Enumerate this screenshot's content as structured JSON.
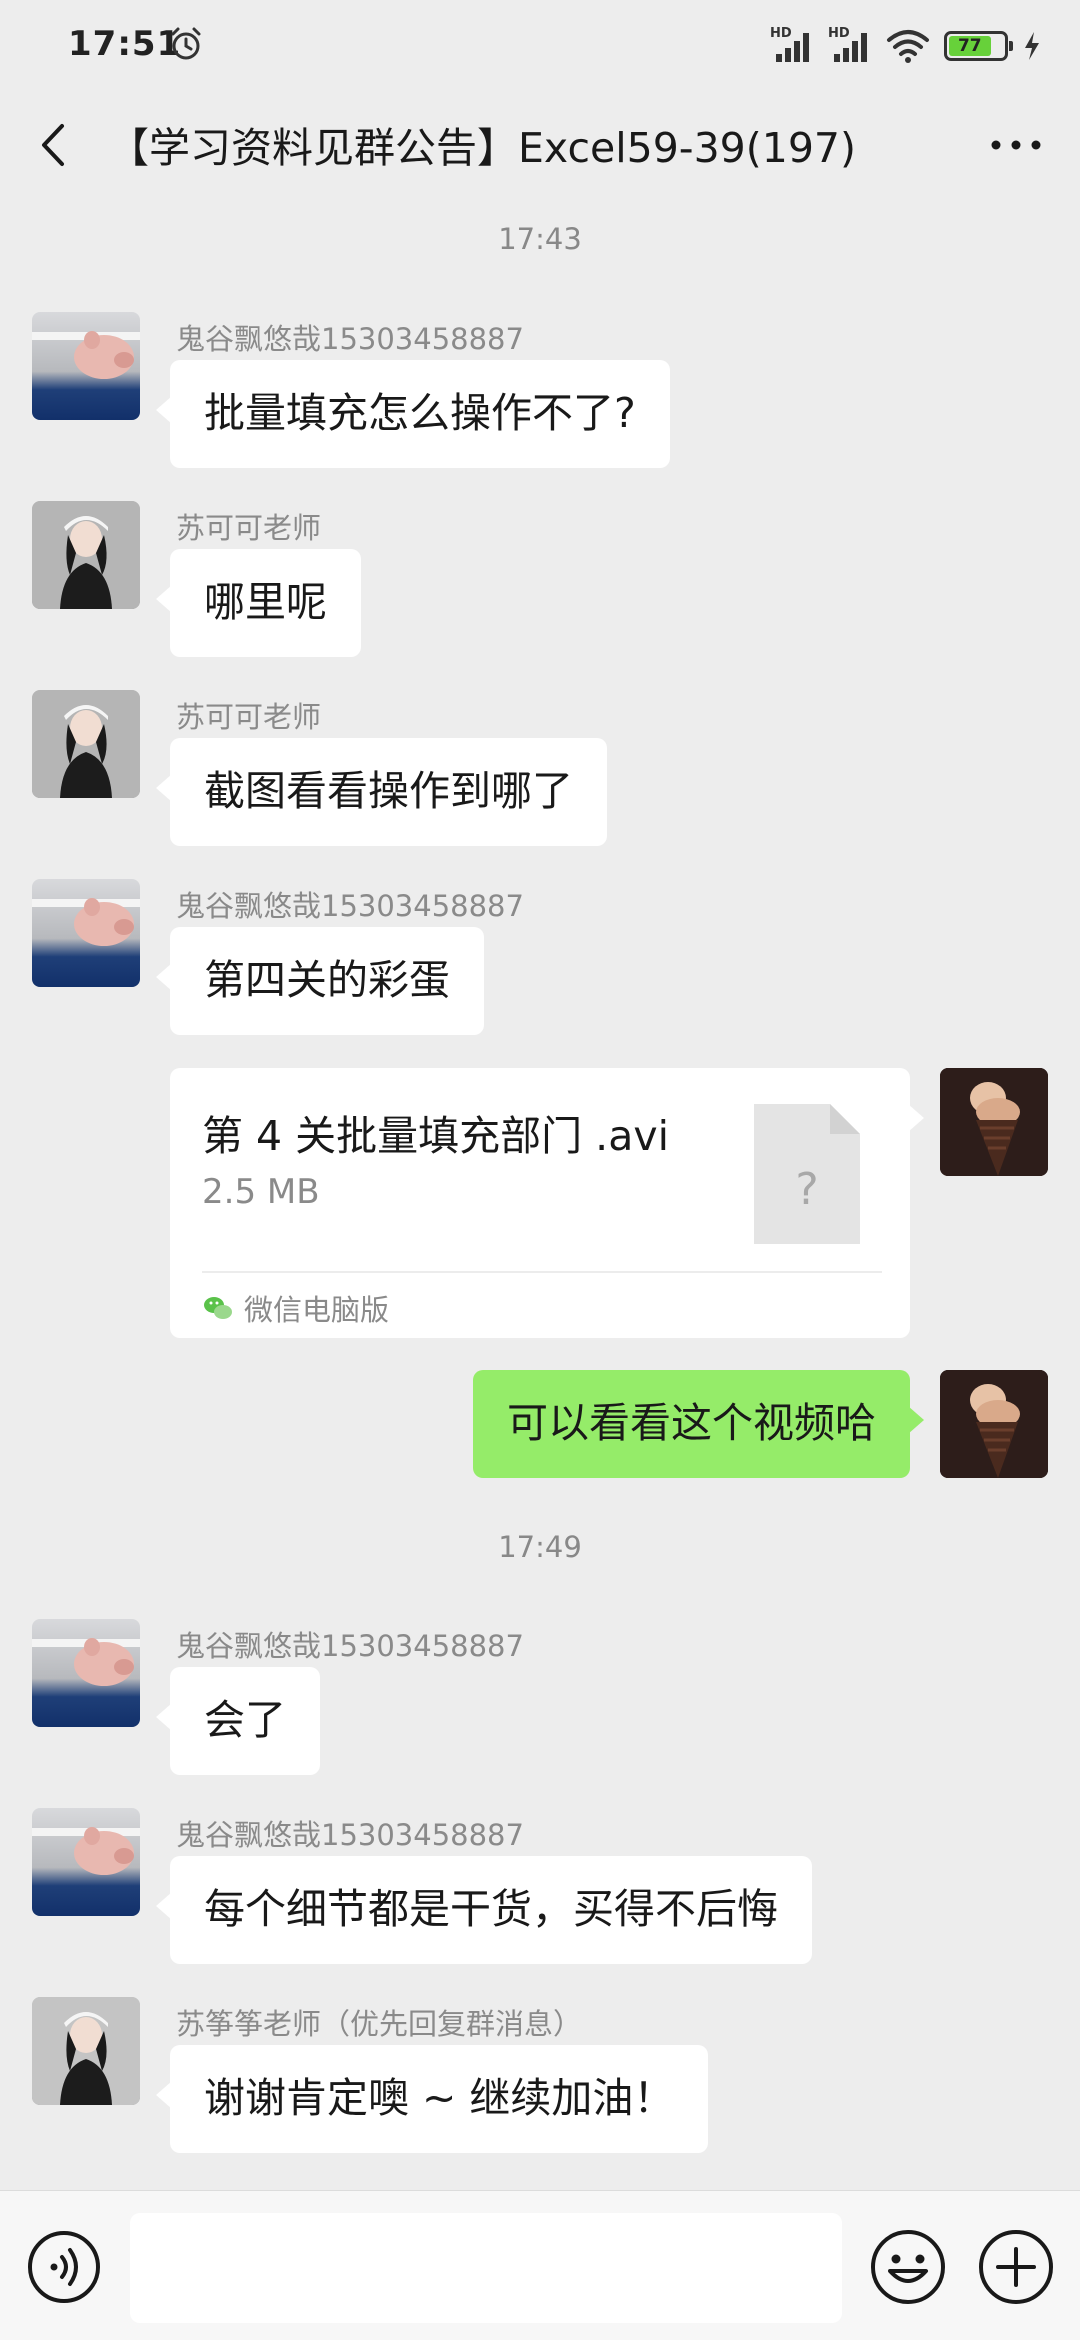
{
  "status_bar": {
    "time": "17:51",
    "battery": "77",
    "signal_label_1": "HD",
    "signal_label_2": "HD"
  },
  "header": {
    "title": "【学习资料见群公告】Excel59-39(197)"
  },
  "messages": {
    "ts1": "17:43",
    "m1_sender": "鬼谷飘悠哉15303458887",
    "m1_text": "批量填充怎么操作不了?",
    "m2_sender": "苏可可老师",
    "m2_text": "哪里呢",
    "m3_sender": "苏可可老师",
    "m3_text": "截图看看操作到哪了",
    "m4_sender": "鬼谷飘悠哉15303458887",
    "m4_text": "第四关的彩蛋",
    "file": {
      "name": "第 4 关批量填充部门 .avi",
      "size": "2.5 MB",
      "icon_glyph": "?",
      "source": "微信电脑版"
    },
    "m6_text": "可以看看这个视频哈",
    "ts2": "17:49",
    "m7_sender": "鬼谷飘悠哉15303458887",
    "m7_text": "会了",
    "m8_sender": "鬼谷飘悠哉15303458887",
    "m8_text": "每个细节都是干货，买得不后悔",
    "m9_sender": "苏筝筝老师（优先回复群消息）",
    "m9_text": "谢谢肯定噢 ~ 继续加油！"
  },
  "input_bar": {
    "placeholder": ""
  },
  "icons": {
    "back": "back-arrow-icon",
    "more": "more-icon",
    "voice": "voice-icon",
    "emoji": "emoji-icon",
    "plus": "plus-icon"
  },
  "colors": {
    "background": "#ededed",
    "outgoing_bubble": "#95ec69",
    "incoming_bubble": "#ffffff",
    "battery": "#67d13a"
  }
}
